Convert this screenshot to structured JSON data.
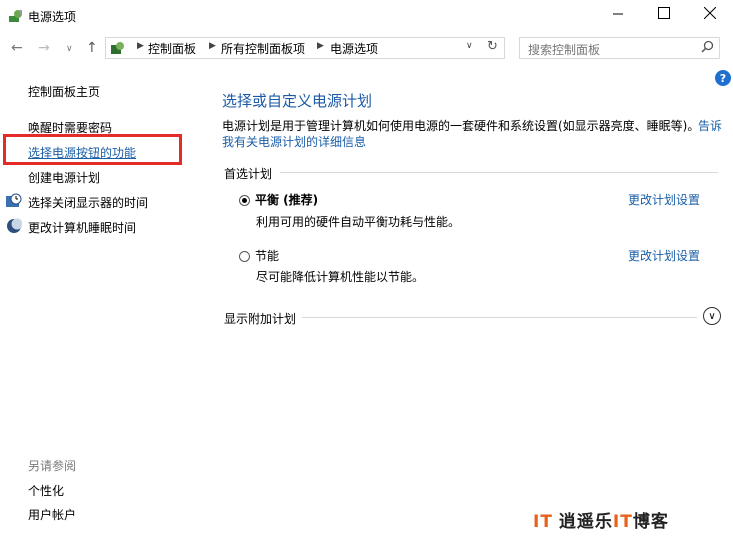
{
  "window": {
    "title": "电源选项",
    "minimize_icon": "minimize-icon",
    "maximize_icon": "maximize-icon",
    "close_icon": "close-icon"
  },
  "nav": {
    "breadcrumb": [
      "控制面板",
      "所有控制面板项",
      "电源选项"
    ],
    "search_placeholder": "搜索控制面板"
  },
  "sidebar": {
    "home": "控制面板主页",
    "items": [
      "唤醒时需要密码",
      "选择电源按钮的功能",
      "创建电源计划",
      "选择关闭显示器的时间",
      "更改计算机睡眠时间"
    ],
    "see_also_label": "另请参阅",
    "see_also": [
      "个性化",
      "用户帐户"
    ]
  },
  "main": {
    "title": "选择或自定义电源计划",
    "description": "电源计划是用于管理计算机如何使用电源的一套硬件和系统设置(如显示器亮度、睡眠等)。",
    "desc_link_part1": "告诉",
    "desc_link_part2": "我有关电源计划的详细信息",
    "preferred_label": "首选计划",
    "plans": [
      {
        "name": "平衡 (推荐)",
        "desc": "利用可用的硬件自动平衡功耗与性能。",
        "selected": true,
        "link": "更改计划设置"
      },
      {
        "name": "节能",
        "desc": "尽可能降低计算机性能以节能。",
        "selected": false,
        "link": "更改计划设置"
      }
    ],
    "show_more_label": "显示附加计划"
  },
  "watermark": {
    "mark": "IT",
    "text_a": "逍遥乐",
    "text_it": "IT",
    "text_b": "博客"
  },
  "colors": {
    "link": "#1a5ea8",
    "title": "#1b5aa5",
    "highlight": "#e52b27"
  }
}
